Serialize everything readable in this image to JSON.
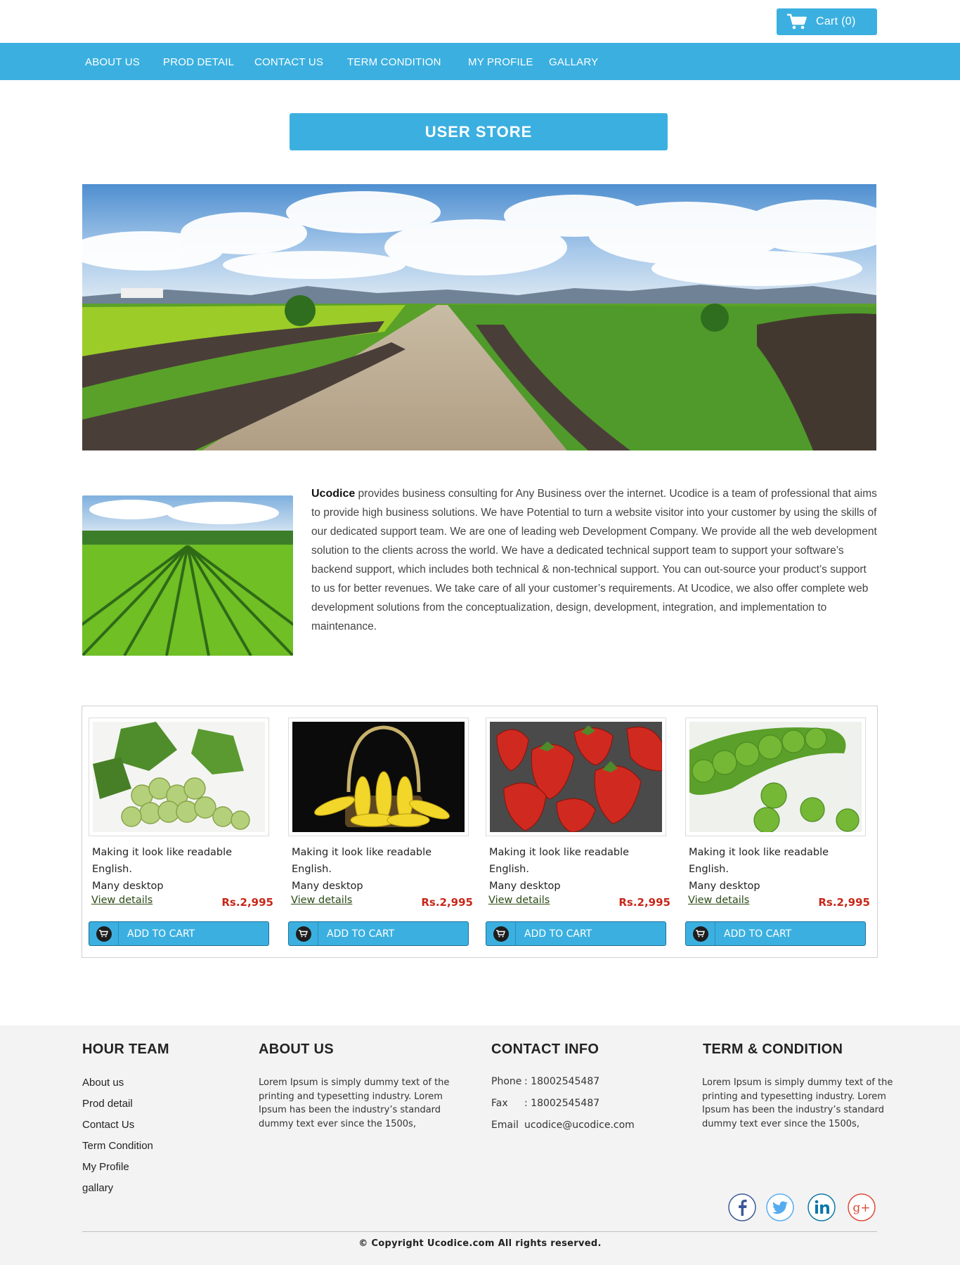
{
  "header": {
    "cart_label": "Cart (0)"
  },
  "nav": {
    "items": [
      {
        "label": "ABOUT US"
      },
      {
        "label": "PROD DETAIL"
      },
      {
        "label": "CONTACT US"
      },
      {
        "label": "TERM CONDITION"
      },
      {
        "label": "MY PROFILE"
      },
      {
        "label": "GALLARY"
      }
    ]
  },
  "store": {
    "title": "USER STORE"
  },
  "about": {
    "brand": "Ucodice",
    "text": " provides business consulting for Any Business over the internet. Ucodice is a team of professional that aims to provide high business solutions. We have Potential to turn a website visitor into your customer by using the skills of our dedicated support team. We are one of leading web Development Company. We provide all the web development solution to the clients across the world.  We have a dedicated technical support team to support your software’s backend support, which includes both technical & non-technical support.  You can out-source your product’s support to us for better revenues. We take care of all your customer’s requirements.  At Ucodice, we also offer complete web development solutions from the conceptualization, design, development, integration, and implementation to maintenance."
  },
  "products": [
    {
      "image": "grapes",
      "desc_line1": "Making it look like readable English.",
      "desc_line2": "Many desktop",
      "view_label": "View details",
      "price": "Rs.2,995",
      "cart_label": "ADD TO CART"
    },
    {
      "image": "corn-basket",
      "desc_line1": "Making it look like readable English.",
      "desc_line2": "Many desktop",
      "view_label": "View details",
      "price": "Rs.2,995",
      "cart_label": "ADD TO CART"
    },
    {
      "image": "strawberries",
      "desc_line1": "Making it look like readable English.",
      "desc_line2": "Many desktop",
      "view_label": "View details",
      "price": "Rs.2,995",
      "cart_label": "ADD TO CART"
    },
    {
      "image": "green-peas",
      "desc_line1": "Making it look like readable English.",
      "desc_line2": "Many desktop",
      "view_label": "View details",
      "price": "Rs.2,995",
      "cart_label": "ADD TO CART"
    }
  ],
  "footer": {
    "team": {
      "title": "HOUR TEAM",
      "links": [
        "About us",
        "Prod detail",
        "Contact Us",
        "Term Condition",
        "My Profile",
        "gallary"
      ]
    },
    "about": {
      "title": "ABOUT US",
      "text": "Lorem Ipsum is simply dummy text of the printing and typesetting industry. Lorem Ipsum has been the industry’s standard dummy text ever since the 1500s,"
    },
    "contact": {
      "title": "CONTACT INFO",
      "phone_label": "Phone",
      "phone": ": 18002545487",
      "fax_label": "Fax",
      "fax": ": 18002545487",
      "email_label": "Email",
      "email": "ucodice@ucodice.com"
    },
    "terms": {
      "title": "TERM & CONDITION",
      "text": "Lorem Ipsum is simply dummy text of the printing and typesetting industry. Lorem Ipsum has been the industry’s standard dummy text ever since the 1500s,"
    },
    "social": [
      "facebook-icon",
      "twitter-icon",
      "linkedin-icon",
      "google-plus-icon"
    ],
    "copyright": "© Copyright Ucodice.com All rights reserved."
  },
  "colors": {
    "accent": "#3bb0e0",
    "price": "#c7281a",
    "footer_bg": "#f3f3f3"
  }
}
